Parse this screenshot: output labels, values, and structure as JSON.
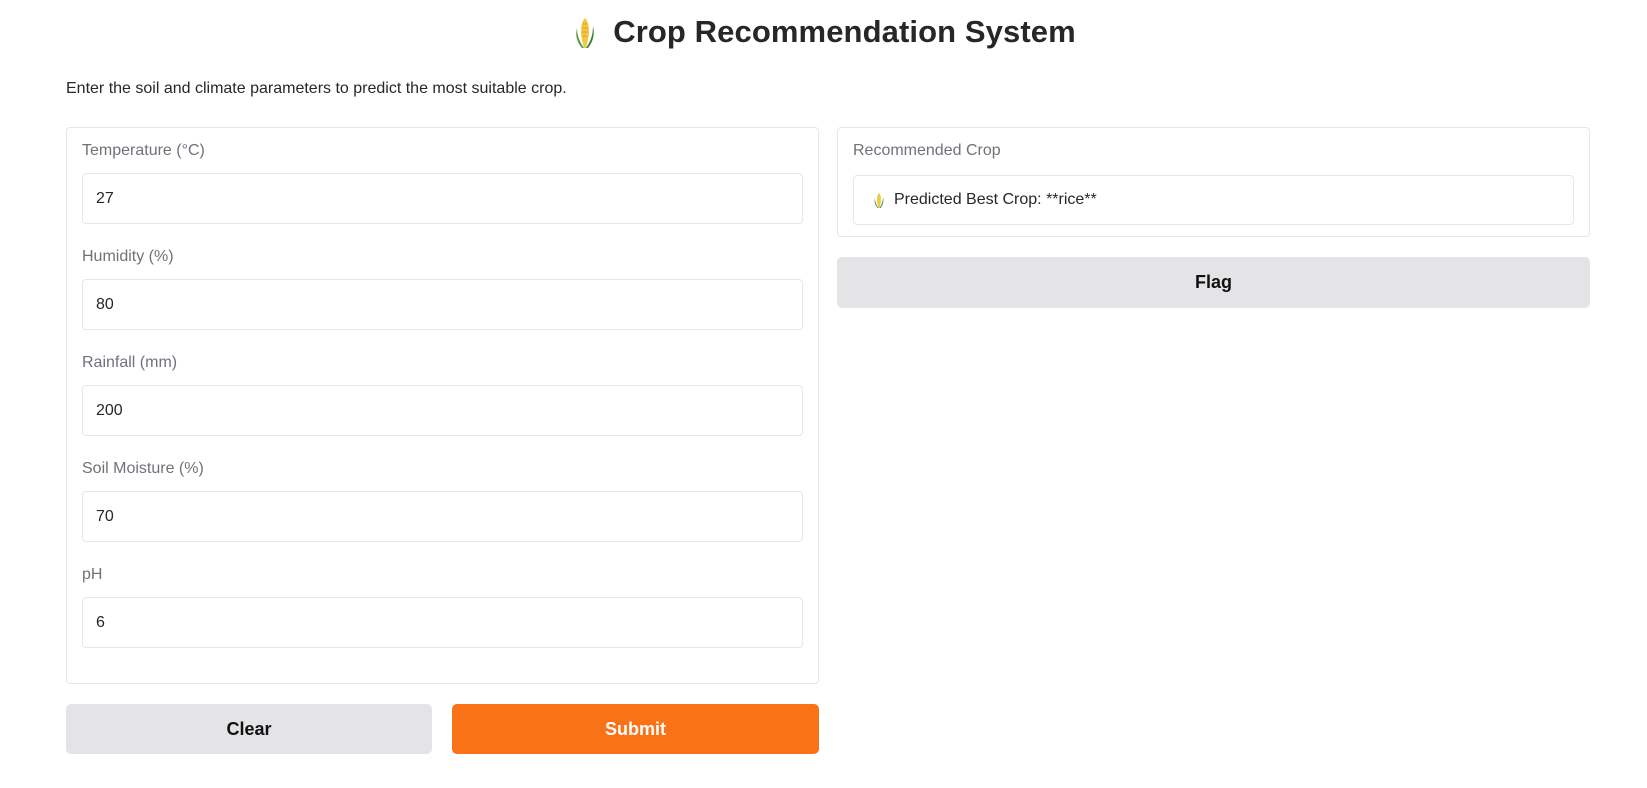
{
  "header": {
    "title": "Crop Recommendation System",
    "icon": "corn-icon"
  },
  "description": "Enter the soil and climate parameters to predict the most suitable crop.",
  "inputs": [
    {
      "label": "Temperature (°C)",
      "value": "27"
    },
    {
      "label": "Humidity (%)",
      "value": "80"
    },
    {
      "label": "Rainfall (mm)",
      "value": "200"
    },
    {
      "label": "Soil Moisture (%)",
      "value": "70"
    },
    {
      "label": "pH",
      "value": "6"
    }
  ],
  "output": {
    "label": "Recommended Crop",
    "text": "Predicted Best Crop: **rice**",
    "icon": "corn-icon"
  },
  "buttons": {
    "flag": "Flag",
    "clear": "Clear",
    "submit": "Submit"
  },
  "colors": {
    "primary": "#f97316",
    "secondary": "#e4e4e7",
    "border": "#e5e7eb",
    "label": "#71717a"
  }
}
